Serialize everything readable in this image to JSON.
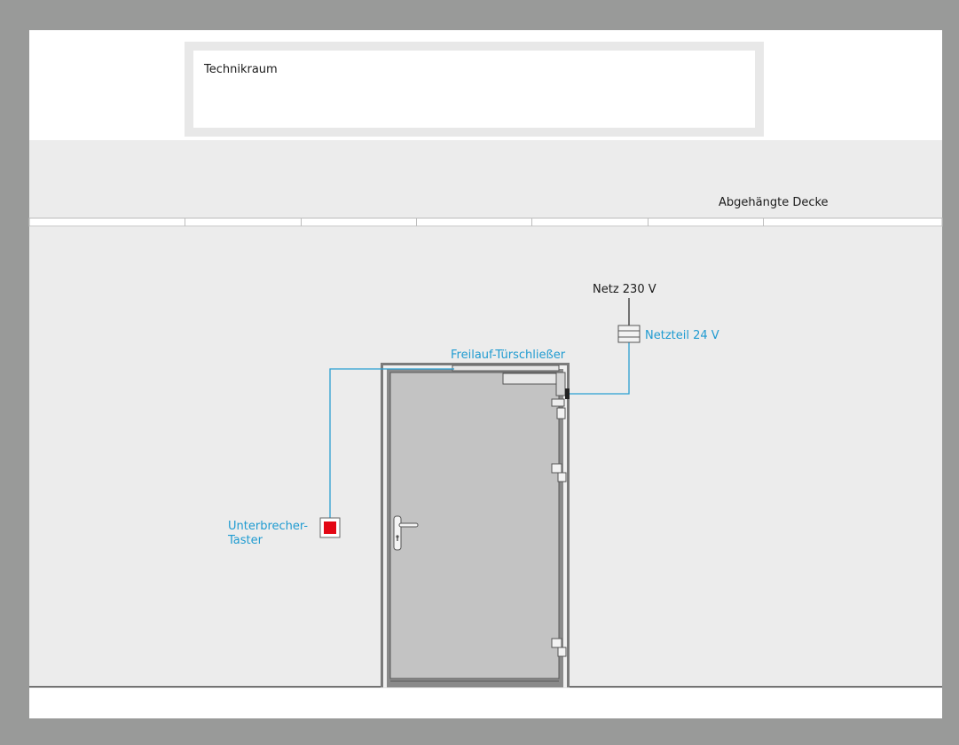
{
  "room_title": "Technikraum",
  "ceiling_label": "Abgehängte Decke",
  "labels": {
    "mains": "Netz 230 V",
    "power_supply": "Netzteil 24 V",
    "door_closer": "Freilauf-Türschließer",
    "button_line1": "Unterbrecher-",
    "button_line2": "Taster"
  },
  "colors": {
    "frame": "#999a99",
    "wall": "#ececec",
    "ceiling": "#ececec",
    "floor": "#ffffff",
    "door_leaf": "#c3c3c3",
    "door_frame": "#7b7b7b",
    "wire": "#2a9ed1",
    "accent_text": "#1f9bd1",
    "button_red": "#e30613"
  }
}
